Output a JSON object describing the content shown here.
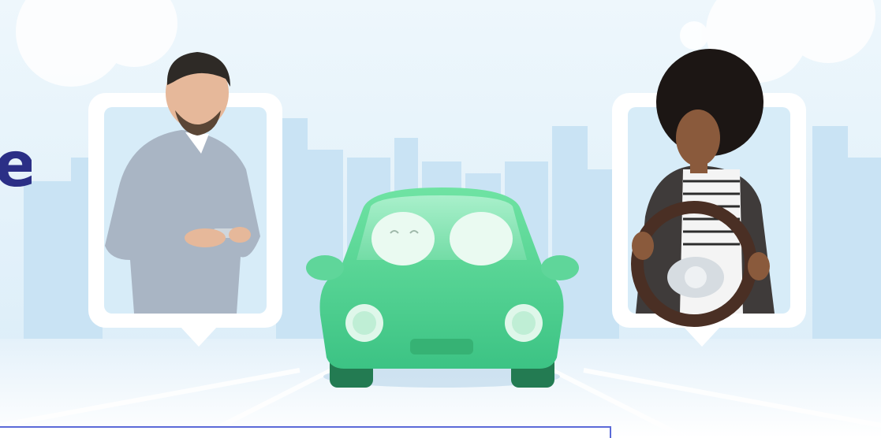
{
  "hero": {
    "edge_letter": "e",
    "colors": {
      "sky": "#e8f4fb",
      "city": "#cfe6f5",
      "car_body": "#4fd38f",
      "car_dark": "#2f9e69",
      "frame": "#ffffff",
      "heading": "#2b2f86",
      "input_border": "#5b6ad8"
    }
  }
}
